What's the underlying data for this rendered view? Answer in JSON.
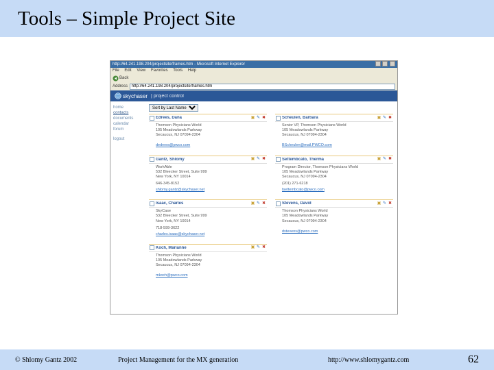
{
  "title": "Tools – Simple Project Site",
  "browser": {
    "window_title": "http://64.241.198.204/projectsite/frames.htm - Microsoft Internet Explorer",
    "menu": [
      "File",
      "Edit",
      "View",
      "Favorites",
      "Tools",
      "Help"
    ],
    "back_label": "Back",
    "address_label": "Address",
    "address_value": "http://64.241.198.204/projectsite/frames.htm"
  },
  "brand": {
    "name": "skychaser",
    "sub": "| project control"
  },
  "sidebar": {
    "items": [
      {
        "label": "home",
        "active": false
      },
      {
        "label": "contacts",
        "active": true
      },
      {
        "label": "documents",
        "active": false
      },
      {
        "label": "calendar",
        "active": false
      },
      {
        "label": "forum",
        "active": false
      }
    ],
    "logout": "logout"
  },
  "sort": {
    "label": "Sort by Last Name"
  },
  "contacts": [
    {
      "name": "Edrees, Dana",
      "org": "Thomson Physicians World",
      "addr1": "105 Meadowlands Parkway",
      "addr2": "Secaucus, NJ  07094-2304",
      "phone": "",
      "email": "dedrees@pwco.com"
    },
    {
      "name": "Scheulen, Barbara",
      "org": "Senior VP, Thomson Physicians World",
      "addr1": "105 Meadowlands Parkway",
      "addr2": "Secaucus, NJ  07094-2304",
      "phone": "",
      "email": "BScheulen@mail.PWCO.com"
    },
    {
      "name": "Gantz, Shlomy",
      "org": "WorkAble",
      "addr1": "532 Bleecker Street, Suite 999",
      "addr2": "New York, NY  10014",
      "phone": "646-345-8152",
      "email": "shlomy.gantz@skychaser.net"
    },
    {
      "name": "Settembcato, Therma",
      "org": "Program Director, Thomson Physicians World",
      "addr1": "105 Meadowlands Parkway",
      "addr2": "Secaucus, NJ  07094-2304",
      "phone": "(201) 271-6218",
      "email": "tsettembcato@pwco.com"
    },
    {
      "name": "Isaac, Charles",
      "org": "SkyCase",
      "addr1": "532 Bleecker Street, Suite 999",
      "addr2": "New York, NY  10014",
      "phone": "718-599-3622",
      "email": "charles.isaac@skychaser.net"
    },
    {
      "name": "Stevens, David",
      "org": "Thomson Physicians World",
      "addr1": "105 Meadowlands Parkway",
      "addr2": "Secaucus, NJ  07094-2304",
      "phone": "",
      "email": "dstevens@pwco.com"
    },
    {
      "name": "Koch, Marianne",
      "org": "Thomson Physicians World",
      "addr1": "105 Meadowlands Parkway",
      "addr2": "Secaucus, NJ  07094-2304",
      "phone": "",
      "email": "mkoch@pwco.com"
    }
  ],
  "footer": {
    "copyright": "© Shlomy Gantz 2002",
    "center": "Project Management for the MX generation",
    "url": "http://www.shlomygantz.com",
    "page": "62"
  }
}
